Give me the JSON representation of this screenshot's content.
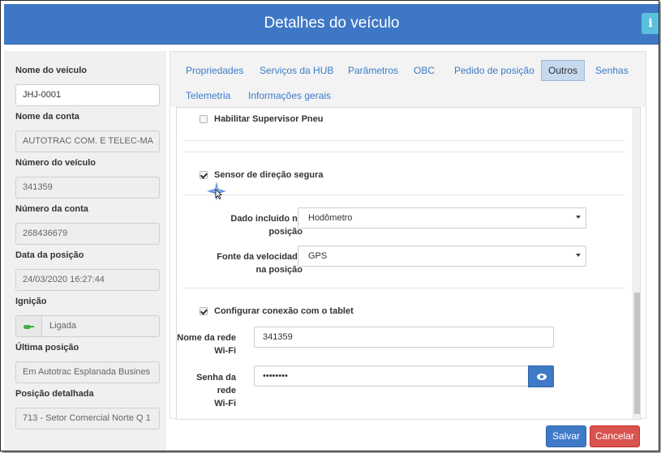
{
  "header": {
    "title": "Detalhes do veículo",
    "info_label": "i"
  },
  "vehicle_fields": [
    {
      "label": "Nome do veículo",
      "value": "JHJ-0001"
    },
    {
      "label": "Nome da conta",
      "value": "AUTOTRAC COM. E TELEC-MA"
    },
    {
      "label": "Número do veículo",
      "value": "341359"
    },
    {
      "label": "Número da conta",
      "value": "268436679"
    },
    {
      "label": "Data da posição",
      "value": "24/03/2020 16:27:44"
    },
    {
      "label": "Ignição",
      "value": "Ligada"
    },
    {
      "label": "Última posição",
      "value": "Em  Autotrac Esplanada Busines"
    },
    {
      "label": "Posição detalhada",
      "value": "713 - Setor Comercial Norte Q 1"
    }
  ],
  "tabs": [
    {
      "label": "Propriedades"
    },
    {
      "label": "Serviços da HUB"
    },
    {
      "label": "Parâmetros"
    },
    {
      "label": "OBC"
    },
    {
      "label": "Pedido de posição"
    },
    {
      "label": "Outros",
      "active": true
    },
    {
      "label": "Senhas"
    },
    {
      "label": "Telemetria"
    },
    {
      "label": "Informações gerais"
    }
  ],
  "outros": {
    "supervisor_pneu": {
      "label": "Habilitar Supervisor Pneu",
      "checked": false
    },
    "sensor_direcao": {
      "label": "Sensor de direção segura",
      "checked": true
    },
    "dado_incluido": {
      "label_line1": "Dado incluido na",
      "label_line2": "posição",
      "value": "Hodômetro"
    },
    "fonte_velocidade": {
      "label_line1": "Fonte da velocidade",
      "label_line2": "na posição",
      "value": "GPS"
    },
    "conexao_tablet": {
      "label": "Configurar conexão com o tablet",
      "checked": true
    },
    "nome_rede": {
      "label_line1": "Nome da rede",
      "label_line2": "Wi-Fi",
      "value": "341359"
    },
    "senha_rede": {
      "label_line1": "Senha da rede",
      "label_line2": "Wi-Fi",
      "value": "••••••••"
    }
  },
  "footer": {
    "save_label": "Salvar",
    "cancel_label": "Cancelar"
  },
  "colors": {
    "header": "#3e78c5",
    "primary": "#3f7ac7",
    "danger": "#d9534f",
    "info": "#5bc0de"
  },
  "icons": [
    "info-icon",
    "key-icon",
    "checkbox-icon",
    "caret-down-icon",
    "eye-icon",
    "mouse-cursor-icon"
  ]
}
